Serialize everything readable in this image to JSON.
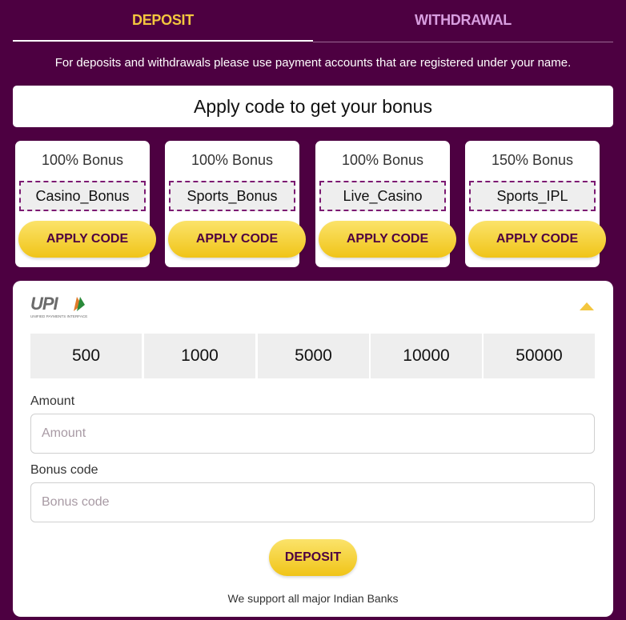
{
  "tabs": [
    {
      "label": "DEPOSIT",
      "active": true
    },
    {
      "label": "WITHDRAWAL",
      "active": false
    }
  ],
  "notice": "For deposits and withdrawals please use payment accounts that are registered under your name.",
  "bonus_header": "Apply code to get your bonus",
  "bonuses": [
    {
      "percent": "100% Bonus",
      "code": "Casino_Bonus",
      "button": "APPLY CODE"
    },
    {
      "percent": "100% Bonus",
      "code": "Sports_Bonus",
      "button": "APPLY CODE"
    },
    {
      "percent": "100% Bonus",
      "code": "Live_Casino",
      "button": "APPLY CODE"
    },
    {
      "percent": "150% Bonus",
      "code": "Sports_IPL",
      "button": "APPLY CODE"
    }
  ],
  "payment": {
    "method_icon": "upi-logo-icon",
    "logo_text": "UPI",
    "logo_subtext": "UNIFIED PAYMENTS INTERFACE",
    "quick_amounts": [
      "500",
      "1000",
      "5000",
      "10000",
      "50000"
    ],
    "amount_label": "Amount",
    "amount_placeholder": "Amount",
    "bonus_label": "Bonus code",
    "bonus_placeholder": "Bonus code",
    "submit": "DEPOSIT",
    "support_note": "We support all major Indian Banks"
  },
  "colors": {
    "background": "#4d0041",
    "accent_yellow": "#f3c63f",
    "tab_inactive": "#d89ee0",
    "code_border": "#7c1a72"
  }
}
